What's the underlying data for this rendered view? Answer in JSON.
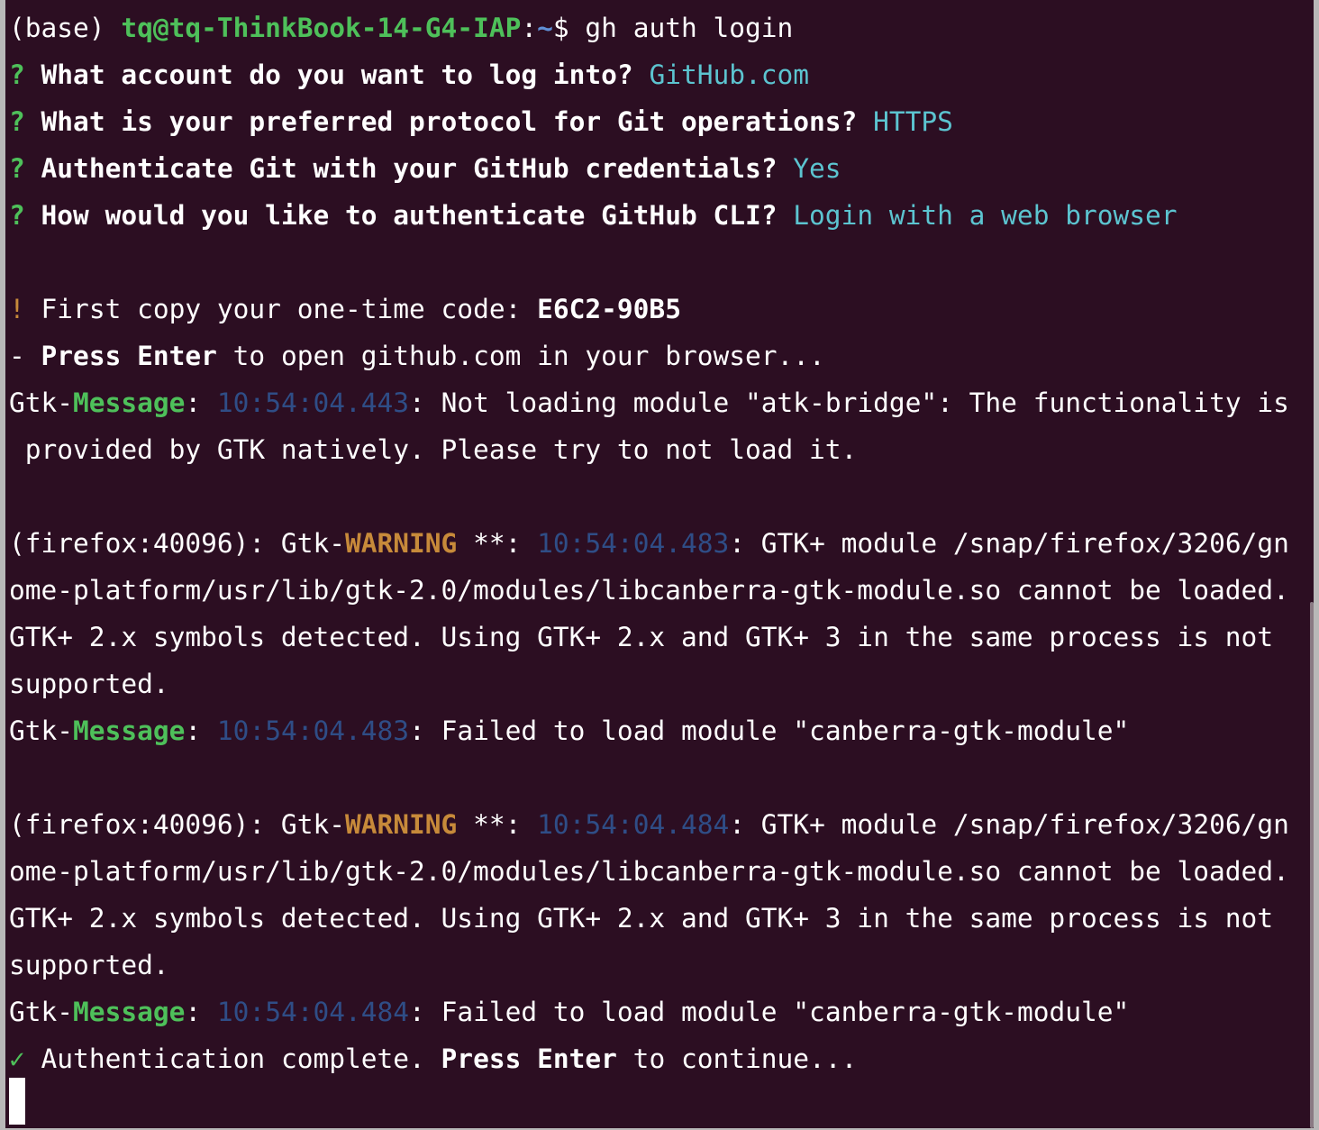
{
  "prompt": {
    "env": "(base) ",
    "user_host": "tq@tq-ThinkBook-14-G4-IAP",
    "separator": ":",
    "path": "~",
    "dollar": "$ ",
    "command": "gh auth login"
  },
  "questions": [
    {
      "mark": "? ",
      "question": "What account do you want to log into? ",
      "answer": "GitHub.com"
    },
    {
      "mark": "? ",
      "question": "What is your preferred protocol for Git operations? ",
      "answer": "HTTPS"
    },
    {
      "mark": "? ",
      "question": "Authenticate Git with your GitHub credentials? ",
      "answer": "Yes"
    },
    {
      "mark": "? ",
      "question": "How would you like to authenticate GitHub CLI? ",
      "answer": "Login with a web browser"
    }
  ],
  "code_line": {
    "mark": "! ",
    "text": "First copy your one-time code: ",
    "code": "E6C2-90B5"
  },
  "press_line": {
    "prefix": "- ",
    "bold": "Press Enter",
    "rest": " to open github.com in your browser..."
  },
  "gtk_message_1": {
    "gtk": "Gtk-",
    "level": "Message",
    "colon": ": ",
    "time": "10:54:04.443",
    "text": ": Not loading module \"atk-bridge\": The functionality is",
    "cont": " provided by GTK natively. Please try to not load it."
  },
  "warning_1": {
    "prefix": "(firefox:40096): Gtk-",
    "level": "WARNING",
    "stars": " **: ",
    "time": "10:54:04.483",
    "text": ": GTK+ module /snap/firefox/3206/gn",
    "cont1": "ome-platform/usr/lib/gtk-2.0/modules/libcanberra-gtk-module.so cannot be loaded.",
    "cont2": "GTK+ 2.x symbols detected. Using GTK+ 2.x and GTK+ 3 in the same process is not",
    "cont3": "supported."
  },
  "gtk_message_2": {
    "gtk": "Gtk-",
    "level": "Message",
    "colon": ": ",
    "time": "10:54:04.483",
    "text": ": Failed to load module \"canberra-gtk-module\""
  },
  "warning_2": {
    "prefix": "(firefox:40096): Gtk-",
    "level": "WARNING",
    "stars": " **: ",
    "time": "10:54:04.484",
    "text": ": GTK+ module /snap/firefox/3206/gn",
    "cont1": "ome-platform/usr/lib/gtk-2.0/modules/libcanberra-gtk-module.so cannot be loaded.",
    "cont2": "GTK+ 2.x symbols detected. Using GTK+ 2.x and GTK+ 3 in the same process is not",
    "cont3": "supported."
  },
  "gtk_message_3": {
    "gtk": "Gtk-",
    "level": "Message",
    "colon": ": ",
    "time": "10:54:04.484",
    "text": ": Failed to load module \"canberra-gtk-module\""
  },
  "complete_line": {
    "mark": "✓ ",
    "text": "Authentication complete. ",
    "bold": "Press Enter",
    "rest": " to continue..."
  },
  "colors": {
    "background": "#2c0e22",
    "green": "#4ec05a",
    "cyan": "#5cc4d0",
    "orange": "#c78a3a",
    "blue": "#2f4d86"
  }
}
